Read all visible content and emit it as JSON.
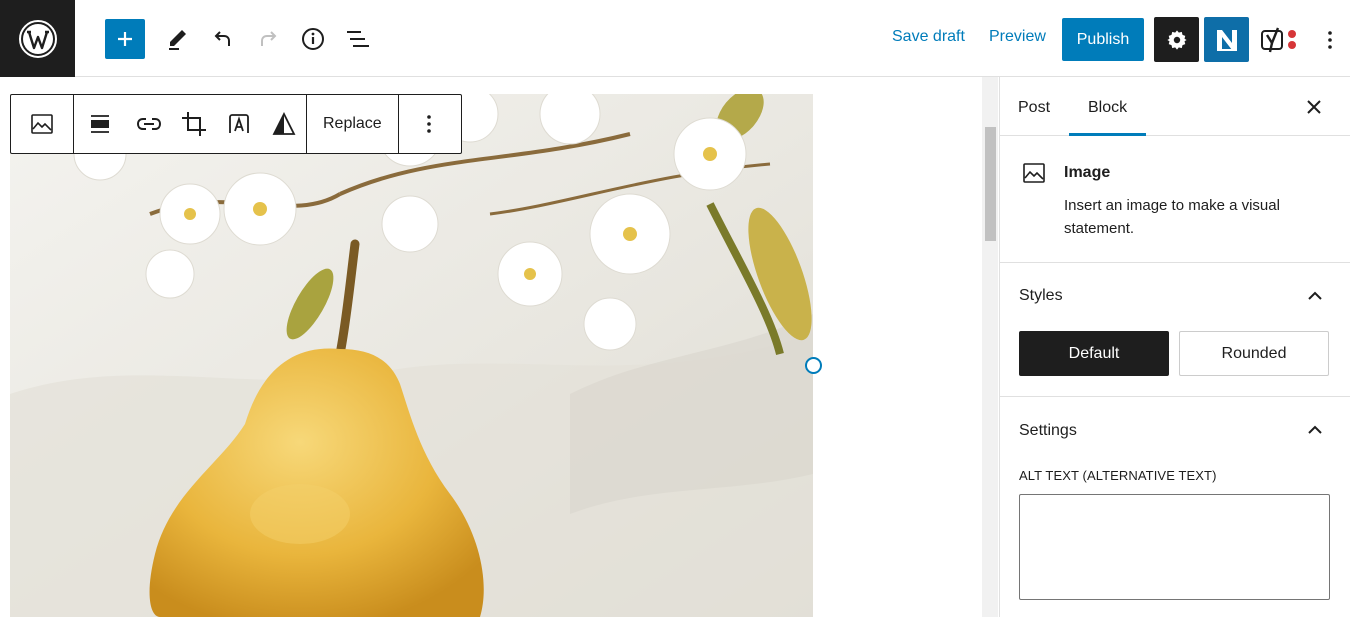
{
  "topbar": {
    "logo_icon": "wordpress-logo-icon",
    "tools": [
      "add-block-icon",
      "pencil-tool-icon",
      "undo-icon",
      "redo-icon",
      "info-icon",
      "list-view-icon"
    ],
    "save_draft": "Save draft",
    "preview": "Preview",
    "publish": "Publish",
    "settings_icon": "gear-icon",
    "plugin_icon": "n-plugin-icon",
    "yoast_icon": "yoast-icon",
    "more_icon": "more-vertical-icon",
    "accent": "#007cba"
  },
  "block_toolbar": {
    "icons": [
      "image-block-icon",
      "align-icon",
      "link-icon",
      "crop-icon",
      "text-overlay-icon",
      "duotone-icon"
    ],
    "replace": "Replace",
    "more_icon": "more-vertical-icon"
  },
  "sidebar": {
    "tabs": [
      {
        "label": "Post",
        "active": false
      },
      {
        "label": "Block",
        "active": true
      }
    ],
    "close_icon": "close-icon",
    "block_card": {
      "icon": "image-block-icon",
      "title": "Image",
      "description": "Insert an image to make a visual statement."
    },
    "styles": {
      "title": "Styles",
      "options": [
        {
          "label": "Default",
          "selected": true
        },
        {
          "label": "Rounded",
          "selected": false
        }
      ]
    },
    "settings": {
      "title": "Settings",
      "alt_label": "ALT TEXT (ALTERNATIVE TEXT)",
      "alt_value": ""
    }
  }
}
